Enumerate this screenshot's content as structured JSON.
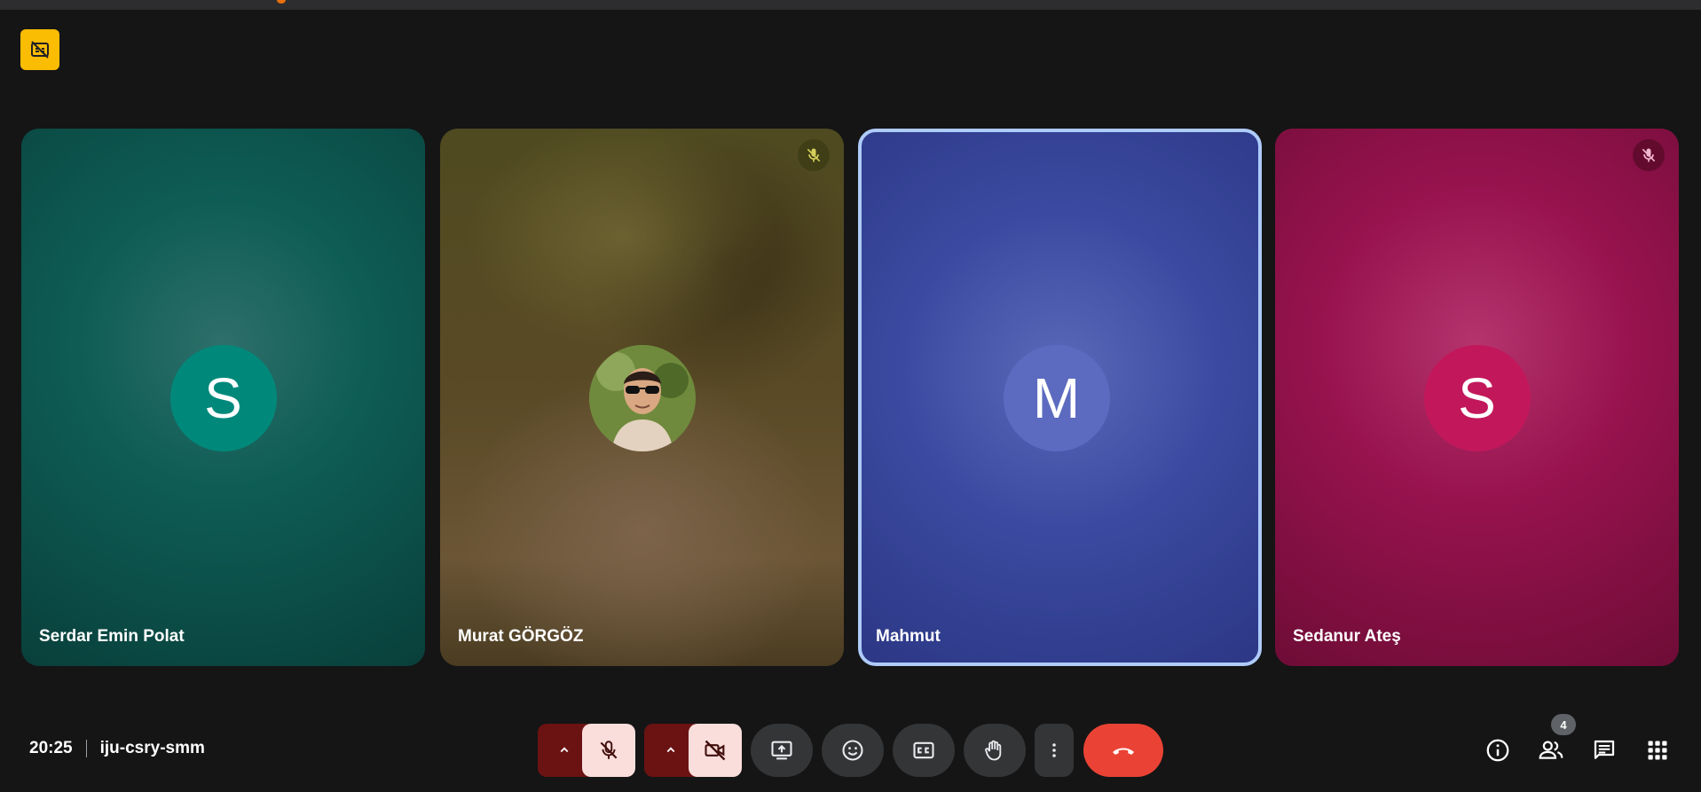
{
  "meeting": {
    "time": "20:25",
    "code": "iju-csry-smm"
  },
  "participants": [
    {
      "name": "Serdar Emin Polat",
      "initial": "S",
      "color": "#00897b",
      "muted": false
    },
    {
      "name": "Murat GÖRGÖZ",
      "initial": "",
      "color": "#5a4a26",
      "muted": true,
      "has_photo": true
    },
    {
      "name": "Mahmut",
      "initial": "M",
      "color": "#5c6bc0",
      "muted": false,
      "active_speaker": true
    },
    {
      "name": "Sedanur Ateş",
      "initial": "S",
      "color": "#c2185b",
      "muted": true
    }
  ],
  "toolbar": {
    "buttons": [
      {
        "name": "audio-options",
        "icon": "chevron-up-icon"
      },
      {
        "name": "microphone-toggle",
        "icon": "mic-off-icon",
        "state": "off"
      },
      {
        "name": "video-options",
        "icon": "chevron-up-icon"
      },
      {
        "name": "camera-toggle",
        "icon": "videocam-off-icon",
        "state": "off"
      },
      {
        "name": "present",
        "icon": "present-screen-icon"
      },
      {
        "name": "reactions",
        "icon": "emoji-icon"
      },
      {
        "name": "captions",
        "icon": "closed-captions-icon"
      },
      {
        "name": "raise-hand",
        "icon": "hand-icon"
      },
      {
        "name": "more-options",
        "icon": "more-vert-icon"
      },
      {
        "name": "leave-call",
        "icon": "call-end-icon"
      }
    ]
  },
  "right_tools": {
    "participant_count": "4",
    "items": [
      "info-icon",
      "people-icon",
      "chat-icon",
      "activities-icon"
    ]
  },
  "colors": {
    "background": "#151515",
    "accent_yellow": "#fbbc04",
    "hangup_red": "#ea4335",
    "active_border": "#aecbfa"
  }
}
